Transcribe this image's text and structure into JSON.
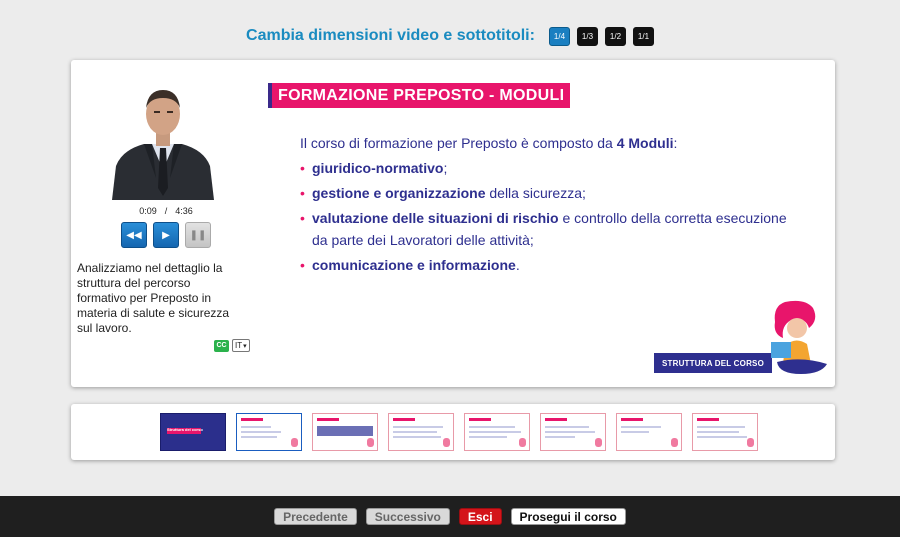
{
  "header": {
    "title": "Cambia dimensioni video e sottotitoli:",
    "sizes": [
      "1/4",
      "1/3",
      "1/2",
      "1/1"
    ]
  },
  "player": {
    "current_time": "0:09",
    "separator": "/",
    "duration": "4:36",
    "rewind_label": "◀◀",
    "play_label": "▶",
    "pause_label": "❚❚"
  },
  "caption": {
    "text": "Analizziamo nel dettaglio la struttura del percorso formativo per Preposto in materia di salute e sicurezza sul lavoro.",
    "cc_label": "CC",
    "language": "IT"
  },
  "slide": {
    "title": "FORMAZIONE PREPOSTO - MODULI",
    "intro_prefix": "Il corso di formazione per Preposto è composto da ",
    "intro_bold": "4 Moduli",
    "intro_suffix": ":",
    "items": [
      {
        "bold": "giuridico-normativo",
        "rest": ";"
      },
      {
        "bold": "gestione e organizzazione",
        "rest": " della sicurezza;"
      },
      {
        "bold": "valutazione delle situazioni di rischio",
        "rest": " e controllo della corretta esecuzione da parte dei Lavoratori delle attività;"
      },
      {
        "bold": "comunicazione e informazione",
        "rest": "."
      }
    ],
    "section_label": "STRUTTURA DEL CORSO"
  },
  "thumbnails": {
    "first_text": "Struttura del corso",
    "count": 8
  },
  "footer": {
    "prev": "Precedente",
    "next": "Successivo",
    "exit": "Esci",
    "continue": "Prosegui il corso"
  },
  "colors": {
    "accent_blue": "#1a8bc0",
    "slide_pink": "#e8156b",
    "slide_navy": "#2e2f8f",
    "exit_red": "#d4141a"
  }
}
